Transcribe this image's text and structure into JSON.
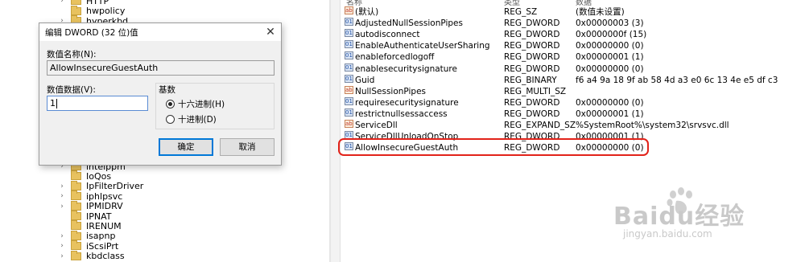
{
  "tree": {
    "items_top": [
      {
        "label": "HTTP",
        "expandable": true
      },
      {
        "label": "hwpolicy",
        "expandable": false
      },
      {
        "label": "hyperkbd",
        "expandable": true
      }
    ],
    "items_bottom": [
      {
        "label": "intelppm",
        "expandable": true
      },
      {
        "label": "IoQos",
        "expandable": false
      },
      {
        "label": "IpFilterDriver",
        "expandable": true
      },
      {
        "label": "iphlpsvc",
        "expandable": true
      },
      {
        "label": "IPMIDRV",
        "expandable": true
      },
      {
        "label": "IPNAT",
        "expandable": false
      },
      {
        "label": "IRENUM",
        "expandable": false
      },
      {
        "label": "isapnp",
        "expandable": true
      },
      {
        "label": "iScsiPrt",
        "expandable": true
      },
      {
        "label": "kbdclass",
        "expandable": true
      }
    ]
  },
  "list": {
    "headers": {
      "name": "名称",
      "type": "类型",
      "data": "数据"
    },
    "rows": [
      {
        "icon": "string-value-icon",
        "name": "(默认)",
        "type": "REG_SZ",
        "data": "(数值未设置)"
      },
      {
        "icon": "binary-value-icon",
        "name": "AdjustedNullSessionPipes",
        "type": "REG_DWORD",
        "data": "0x00000003 (3)"
      },
      {
        "icon": "binary-value-icon",
        "name": "autodisconnect",
        "type": "REG_DWORD",
        "data": "0x0000000f (15)"
      },
      {
        "icon": "binary-value-icon",
        "name": "EnableAuthenticateUserSharing",
        "type": "REG_DWORD",
        "data": "0x00000000 (0)"
      },
      {
        "icon": "binary-value-icon",
        "name": "enableforcedlogoff",
        "type": "REG_DWORD",
        "data": "0x00000001 (1)"
      },
      {
        "icon": "binary-value-icon",
        "name": "enablesecuritysignature",
        "type": "REG_DWORD",
        "data": "0x00000000 (0)"
      },
      {
        "icon": "binary-value-icon",
        "name": "Guid",
        "type": "REG_BINARY",
        "data": "f6 a4 9a 18 9f ab 58 4d a3 e0 6c 13 4e e5 df c3"
      },
      {
        "icon": "string-value-icon",
        "name": "NullSessionPipes",
        "type": "REG_MULTI_SZ",
        "data": ""
      },
      {
        "icon": "binary-value-icon",
        "name": "requiresecuritysignature",
        "type": "REG_DWORD",
        "data": "0x00000000 (0)"
      },
      {
        "icon": "binary-value-icon",
        "name": "restrictnullsessaccess",
        "type": "REG_DWORD",
        "data": "0x00000001 (1)"
      },
      {
        "icon": "string-value-icon",
        "name": "ServiceDll",
        "type": "REG_EXPAND_SZ",
        "data": "%SystemRoot%\\system32\\srvsvc.dll"
      },
      {
        "icon": "binary-value-icon",
        "name": "ServiceDllUnloadOnStop",
        "type": "REG_DWORD",
        "data": "0x00000001 (1)"
      },
      {
        "icon": "binary-value-icon",
        "name": "AllowInsecureGuestAuth",
        "type": "REG_DWORD",
        "data": "0x00000000 (0)"
      }
    ],
    "highlight_color": "#e2231a"
  },
  "dialog": {
    "title": "编辑 DWORD (32 位)值",
    "value_name_label": "数值名称(N):",
    "value_name": "AllowInsecureGuestAuth",
    "value_data_label": "数值数据(V):",
    "value_data": "1",
    "base_label": "基数",
    "radio_hex": "十六进制(H)",
    "radio_dec": "十进制(D)",
    "selected_base": "hex",
    "ok_label": "确定",
    "cancel_label": "取消"
  },
  "watermark": {
    "brand": "Baidu经验",
    "url": "jingyan.baidu.com"
  }
}
